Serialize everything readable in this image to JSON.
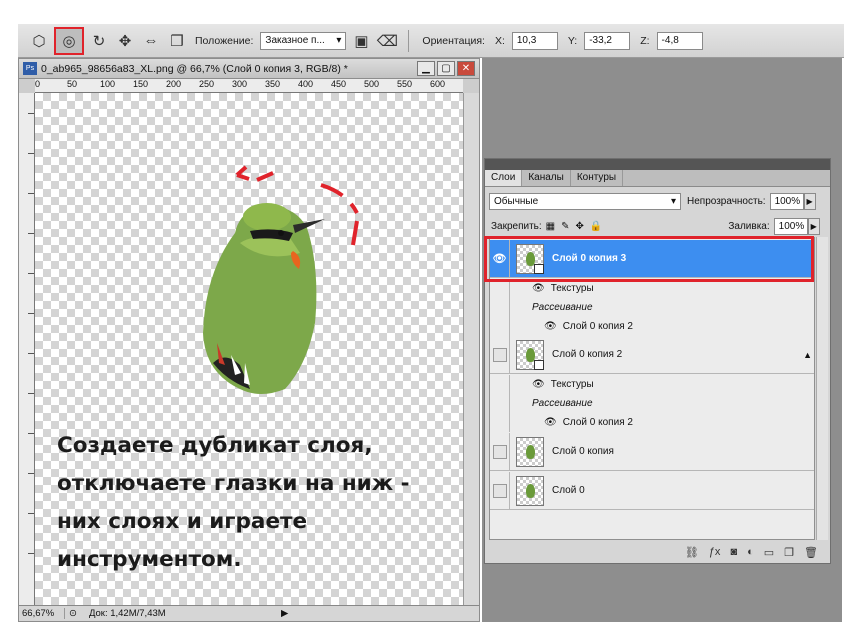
{
  "toolbar": {
    "position_label": "Положение:",
    "position_value": "Заказное п...",
    "orientation_label": "Ориентация:",
    "x_label": "X:",
    "x_value": "10,3",
    "y_label": "Y:",
    "y_value": "-33,2",
    "z_label": "Z:",
    "z_value": "-4,8"
  },
  "document": {
    "title": "0_ab965_98656a83_XL.png @ 66,7% (Слой 0 копия 3, RGB/8) *",
    "ruler_ticks": [
      "0",
      "50",
      "100",
      "150",
      "200",
      "250",
      "300",
      "350",
      "400",
      "450",
      "500",
      "550",
      "600"
    ],
    "zoom": "66,67%",
    "doc_info": "Док: 1,42M/7,43M"
  },
  "caption": {
    "line1": "Создаете дубликат слоя,",
    "line2": "отключаете глазки на ниж -",
    "line3": "них слоях и играете",
    "line4": "инструментом."
  },
  "panel": {
    "tabs": [
      "Слои",
      "Каналы",
      "Контуры"
    ],
    "blend_mode": "Обычные",
    "opacity_label": "Непрозрачность:",
    "opacity_value": "100%",
    "lock_label": "Закрепить:",
    "fill_label": "Заливка:",
    "fill_value": "100%",
    "layers": [
      {
        "name": "Слой 0 копия 3",
        "effect1": "Текстуры",
        "effect2": "Рассеивание",
        "source": "Слой 0 копия 2"
      },
      {
        "name": "Слой 0 копия 2",
        "effect1": "Текстуры",
        "effect2": "Рассеивание",
        "source": "Слой 0 копия 2"
      },
      {
        "name": "Слой 0 копия"
      },
      {
        "name": "Слой 0"
      }
    ]
  },
  "colors": {
    "highlight": "#e0232b",
    "selection": "#3d8ef0"
  }
}
